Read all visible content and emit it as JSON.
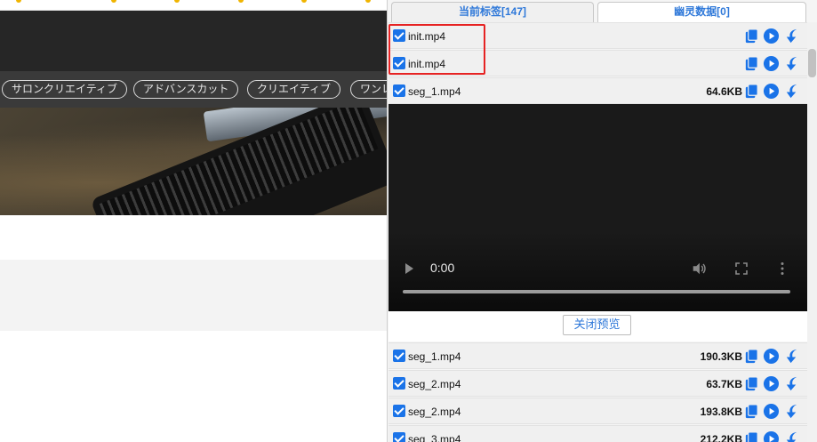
{
  "background_page": {
    "tags": [
      "サロンクリエイティブ",
      "アドバンスカット",
      "クリエイティブ",
      "ワンレ"
    ]
  },
  "panel": {
    "tabs": [
      {
        "label": "当前标签[147]",
        "active": false
      },
      {
        "label": "幽灵数据[0]",
        "active": true
      }
    ],
    "rows": [
      {
        "name": "init.mp4",
        "size": "",
        "checked": true
      },
      {
        "name": "init.mp4",
        "size": "",
        "checked": true
      },
      {
        "name": "seg_1.mp4",
        "size": "64.6KB",
        "checked": true
      },
      {
        "name": "seg_1.mp4",
        "size": "190.3KB",
        "checked": true
      },
      {
        "name": "seg_2.mp4",
        "size": "63.7KB",
        "checked": true
      },
      {
        "name": "seg_2.mp4",
        "size": "193.8KB",
        "checked": true
      },
      {
        "name": "seg_3.mp4",
        "size": "212.2KB",
        "checked": true
      }
    ],
    "video": {
      "time": "0:00",
      "progress": 0
    },
    "close_preview_label": "关闭预览"
  },
  "colors": {
    "accent": "#1a73e8",
    "tab_text": "#2e78d9",
    "highlight": "#e62323"
  },
  "icons": [
    "copy-icon",
    "play-icon",
    "download-icon",
    "volume-icon",
    "fullscreen-icon",
    "more-vert-icon"
  ]
}
